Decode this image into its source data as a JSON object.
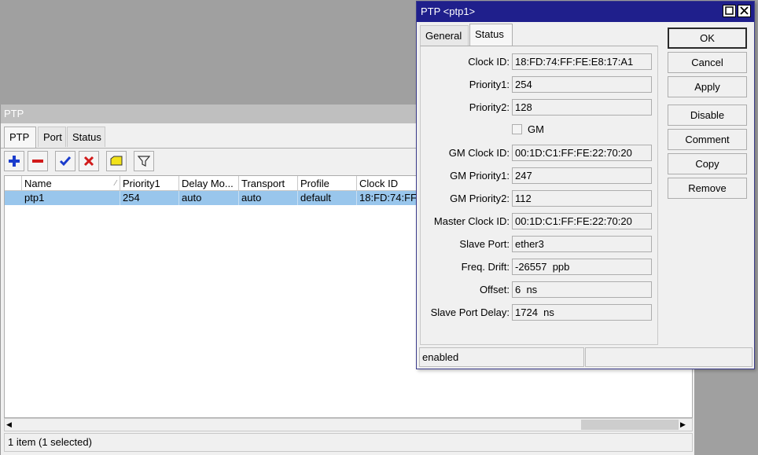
{
  "list_window": {
    "title": "PTP",
    "tabs": [
      {
        "label": "PTP",
        "active": true
      },
      {
        "label": "Port",
        "active": false
      },
      {
        "label": "Status",
        "active": false
      }
    ],
    "toolbar": [
      "add-icon",
      "remove-icon",
      "enable-icon",
      "disable-icon",
      "comment-icon",
      "filter-icon"
    ],
    "columns": [
      "Name",
      "Priority1",
      "Delay Mo...",
      "Transport",
      "Profile",
      "Clock ID"
    ],
    "rows": [
      {
        "name": "ptp1",
        "priority1": "254",
        "delay_mode": "auto",
        "transport": "auto",
        "profile": "default",
        "clock_id": "18:FD:74:FF:"
      }
    ],
    "status": "1 item (1 selected)"
  },
  "dialog": {
    "title": "PTP <ptp1>",
    "tabs": [
      {
        "label": "General",
        "active": false
      },
      {
        "label": "Status",
        "active": true
      }
    ],
    "fields": {
      "clock_id": {
        "label": "Clock ID:",
        "value": "18:FD:74:FF:FE:E8:17:A1"
      },
      "priority1": {
        "label": "Priority1:",
        "value": "254"
      },
      "priority2": {
        "label": "Priority2:",
        "value": "128"
      },
      "gm": {
        "label": "GM",
        "checked": false
      },
      "gm_clock_id": {
        "label": "GM Clock ID:",
        "value": "00:1D:C1:FF:FE:22:70:20"
      },
      "gm_priority1": {
        "label": "GM Priority1:",
        "value": "247"
      },
      "gm_priority2": {
        "label": "GM Priority2:",
        "value": "112"
      },
      "master_clock_id": {
        "label": "Master Clock ID:",
        "value": "00:1D:C1:FF:FE:22:70:20"
      },
      "slave_port": {
        "label": "Slave Port:",
        "value": "ether3"
      },
      "freq_drift": {
        "label": "Freq. Drift:",
        "value": "-26557  ppb"
      },
      "offset": {
        "label": "Offset:",
        "value": "6  ns"
      },
      "slave_port_delay": {
        "label": "Slave Port Delay:",
        "value": "1724  ns"
      }
    },
    "buttons": {
      "ok": "OK",
      "cancel": "Cancel",
      "apply": "Apply",
      "disable": "Disable",
      "comment": "Comment",
      "copy": "Copy",
      "remove": "Remove"
    },
    "status_left": "enabled",
    "status_right": ""
  }
}
